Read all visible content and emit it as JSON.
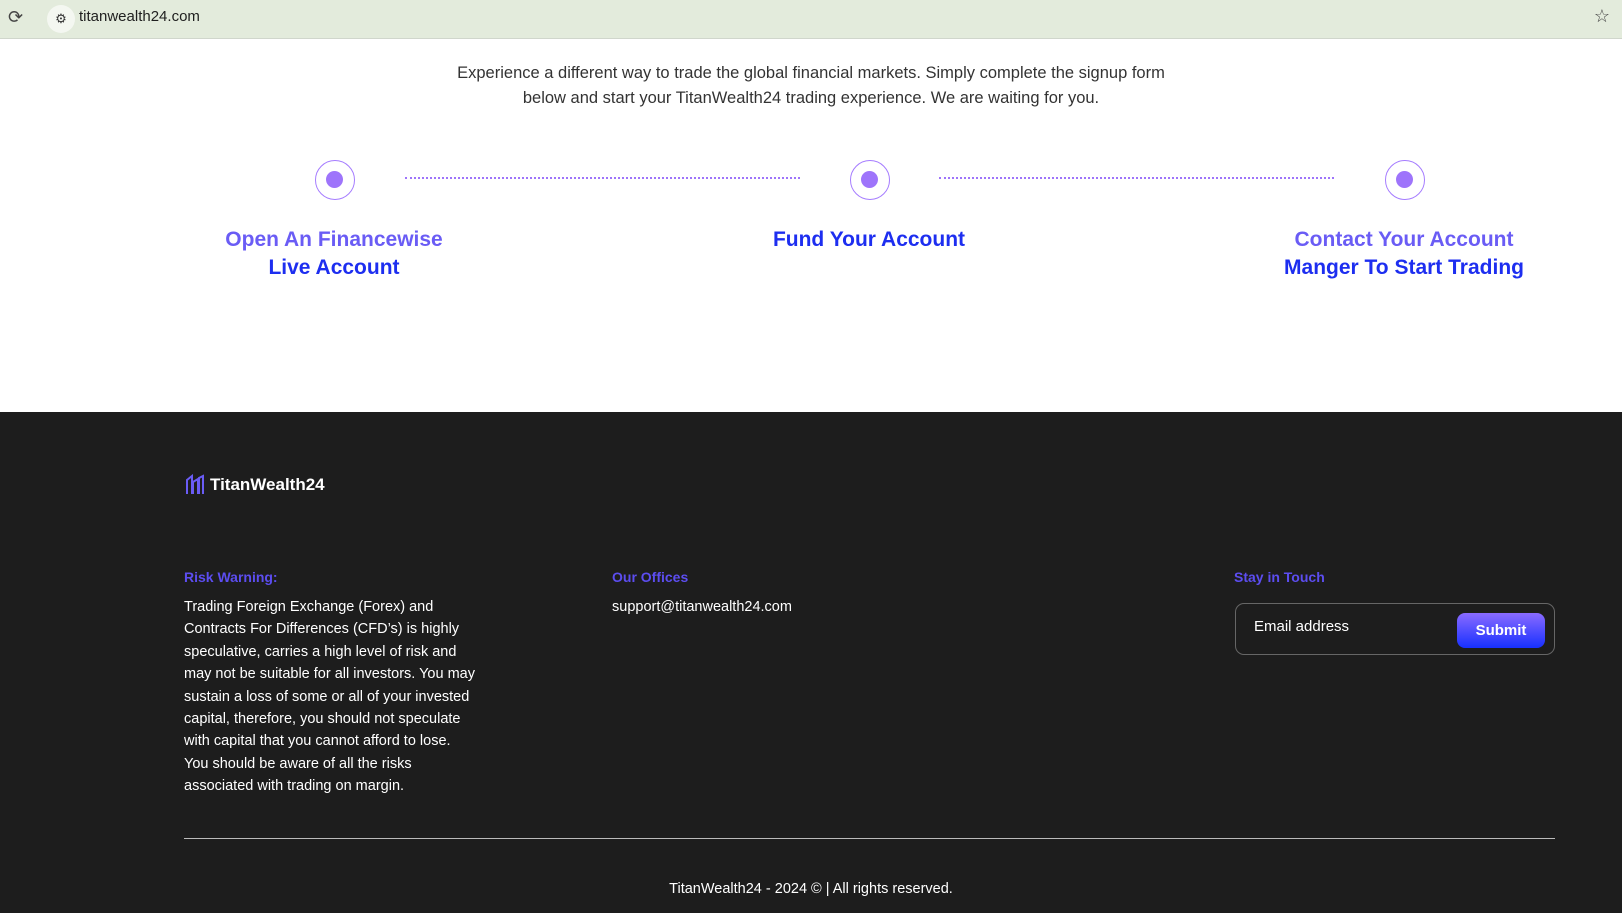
{
  "browser": {
    "url": "titanwealth24.com"
  },
  "intro": {
    "line1": "Experience a different way to trade the global financial markets. Simply complete the signup form",
    "line2": "below and start your TitanWealth24 trading experience. We are waiting for you."
  },
  "steps": [
    {
      "line1": "Open An Financewise",
      "line2": "Live Account"
    },
    {
      "line1": "Fund Your Account",
      "line2": ""
    },
    {
      "line1": "Contact Your Account",
      "line2": "Manger To Start Trading"
    }
  ],
  "footer": {
    "brand": "TitanWealth24",
    "risk_heading": "Risk Warning:",
    "risk_lines": [
      "Trading Foreign Exchange (Forex) and",
      "Contracts For Differences (CFD’s) is highly",
      "speculative, carries a high level of risk and",
      "may not be suitable for all investors. You may",
      "sustain a loss of some or all of your invested",
      "capital, therefore, you should not speculate",
      "with capital that you cannot afford to lose.",
      "You should be aware of all the risks",
      "associated with trading on margin."
    ],
    "offices_heading": "Our Offices",
    "email": "support@titanwealth24.com",
    "touch_heading": "Stay in Touch",
    "email_placeholder": "Email address",
    "submit_label": "Submit",
    "copyright": "TitanWealth24 - 2024 © | All rights reserved."
  }
}
